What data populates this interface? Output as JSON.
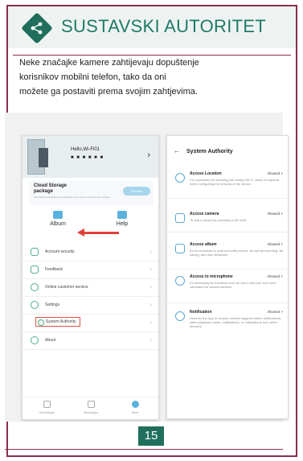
{
  "header": {
    "title": "SUSTAVSKI AUTORITET",
    "brand_color": "#1f7a68",
    "border_color": "#8a2e4a"
  },
  "intro": {
    "lines": [
      "Neke značajke kamere zahtijevaju dopuštenje",
      "korisnikov mobilni telefon, tako da oni",
      "možete ga postaviti prema svojim zahtjevima."
    ]
  },
  "left_screen": {
    "hello": "Hello,Wi-Fi01",
    "hello_sub": "■ ■ ■ ■ ■ ■",
    "cloud_title_1": "Cloud Storage",
    "cloud_title_2": "package",
    "cloud_desc": "Information encrypted and uploaded to the cloud, convenient to retrieve",
    "cloud_button": "Activate",
    "album": "Album",
    "help": "Help",
    "menu": [
      {
        "label": "Account security"
      },
      {
        "label": "Feedback"
      },
      {
        "label": "Online customer service"
      },
      {
        "label": "Settings"
      },
      {
        "label": "System Authority"
      },
      {
        "label": "About"
      }
    ],
    "tabs": [
      {
        "label": "Homepage"
      },
      {
        "label": "Messages"
      },
      {
        "label": "Mine"
      }
    ]
  },
  "right_screen": {
    "title": "System Authority",
    "permissions": [
      {
        "title": "Access Location",
        "status": "Allowed >",
        "desc": "It is necessary for scanning the nearby Wi-Fi, which is required when configuring the network of the device."
      },
      {
        "title": "Access camera",
        "status": "Allowed >",
        "desc": "To add a device by scanning a QR code"
      },
      {
        "title": "Access album",
        "status": "Allowed >",
        "desc": "It'll be accessed to read and write photos, as well as scanning, file saving, and user feedback."
      },
      {
        "title": "Access to microphone",
        "status": "Allowed >",
        "desc": "It's necessary for functions such as video intercom and voice command for bonded devices."
      },
      {
        "title": "Notification",
        "status": "Allowed >",
        "desc": "Used for the App to receive camera triggered alarm notifications, video playback notice, notifications, or notifications from other services"
      }
    ]
  },
  "page_number": "15",
  "colors": {
    "accent": "#1f6f5c",
    "highlight": "#e0403a",
    "toggle": "#5ab3de"
  }
}
